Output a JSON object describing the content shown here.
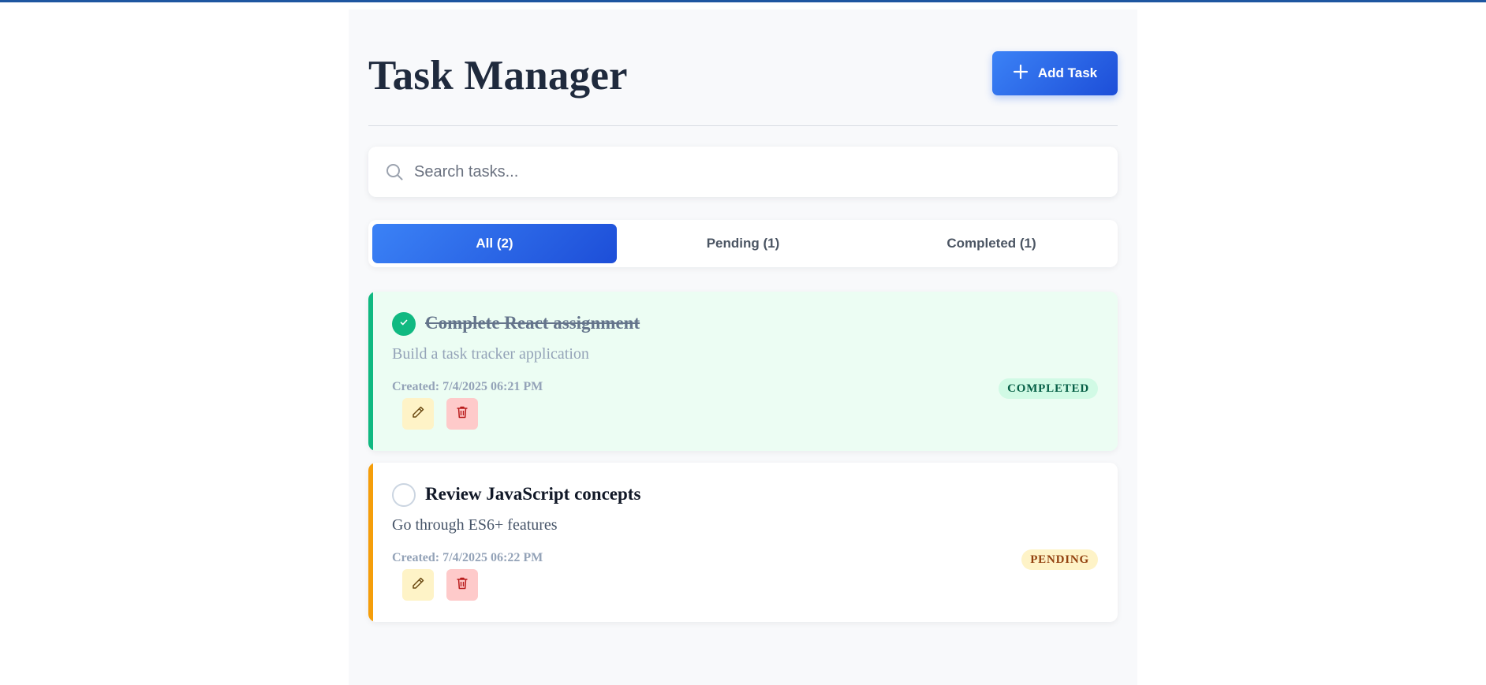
{
  "header": {
    "title": "Task Manager",
    "add_label": "Add Task"
  },
  "search": {
    "placeholder": "Search tasks...",
    "value": ""
  },
  "filters": [
    {
      "label": "All (2)",
      "active": true
    },
    {
      "label": "Pending (1)",
      "active": false
    },
    {
      "label": "Completed (1)",
      "active": false
    }
  ],
  "tasks": [
    {
      "title": "Complete React assignment",
      "description": "Build a task tracker application",
      "created": "Created: 7/4/2025 06:21 PM",
      "status": "COMPLETED",
      "completed": true
    },
    {
      "title": "Review JavaScript concepts",
      "description": "Go through ES6+ features",
      "created": "Created: 7/4/2025 06:22 PM",
      "status": "PENDING",
      "completed": false
    }
  ],
  "icons": {
    "add": "plus-icon",
    "search": "search-icon",
    "check": "check-icon",
    "edit": "pencil-icon",
    "delete": "trash-icon"
  },
  "colors": {
    "accent": "#2563eb",
    "completed": "#10b981",
    "pending": "#f59e0b",
    "title": "#1f2a3d"
  }
}
